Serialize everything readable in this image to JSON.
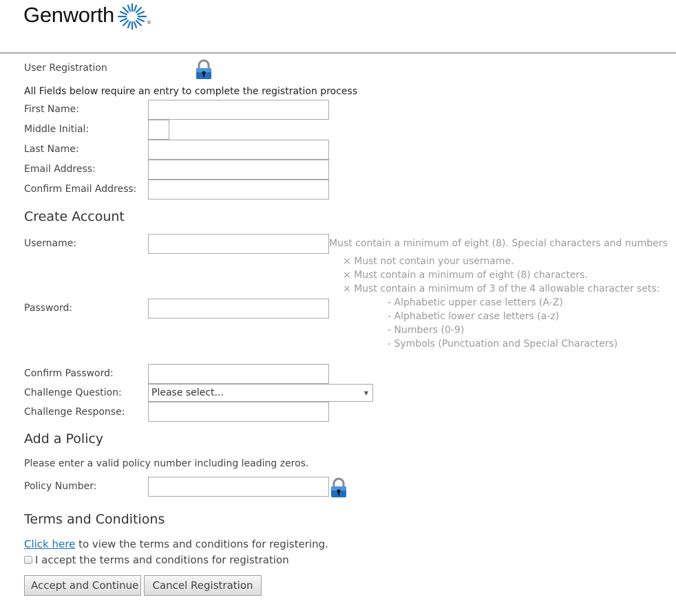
{
  "brand": {
    "name": "Genworth",
    "mark": "®"
  },
  "header": {
    "title": "User Registration",
    "instruction": "All Fields below require an entry to complete the registration process"
  },
  "personal": {
    "first_name_label": "First Name:",
    "first_name_value": "",
    "middle_initial_label": "Middle Initial:",
    "middle_initial_value": "",
    "last_name_label": "Last Name:",
    "last_name_value": "",
    "email_label": "Email Address:",
    "email_value": "",
    "confirm_email_label": "Confirm Email Address:",
    "confirm_email_value": ""
  },
  "account": {
    "heading": "Create Account",
    "username_label": "Username:",
    "username_value": "",
    "username_hint": "Must contain a minimum of eight (8). Special characters and numbers",
    "password_label": "Password:",
    "password_value": "",
    "password_rules": [
      "Must not contain your username.",
      "Must contain a minimum of eight (8) characters.",
      "Must contain a minimum of 3 of the 4 allowable character sets:"
    ],
    "character_sets": [
      "- Alphabetic upper case letters (A-Z)",
      "- Alphabetic lower case letters (a-z)",
      "- Numbers (0-9)",
      "- Symbols (Punctuation and Special Characters)"
    ],
    "rule_icon": "×",
    "confirm_password_label": "Confirm Password:",
    "confirm_password_value": "",
    "challenge_question_label": "Challenge Question:",
    "challenge_question_selected": "Please select...",
    "challenge_response_label": "Challenge Response:",
    "challenge_response_value": ""
  },
  "policy": {
    "heading": "Add a Policy",
    "instruction": "Please enter a valid policy number including leading zeros.",
    "policy_number_label": "Policy Number:",
    "policy_number_value": ""
  },
  "terms": {
    "heading": "Terms and Conditions",
    "link_text": "Click here",
    "link_suffix": " to view the terms and conditions for registering.",
    "accept_label": "I accept the terms and conditions for registration",
    "accepted": false
  },
  "buttons": {
    "accept": "Accept and Continue",
    "cancel": "Cancel Registration"
  },
  "colors": {
    "brand_blue": "#1a73c9",
    "link": "#1a6fb5",
    "hint": "#9a9a9a"
  }
}
